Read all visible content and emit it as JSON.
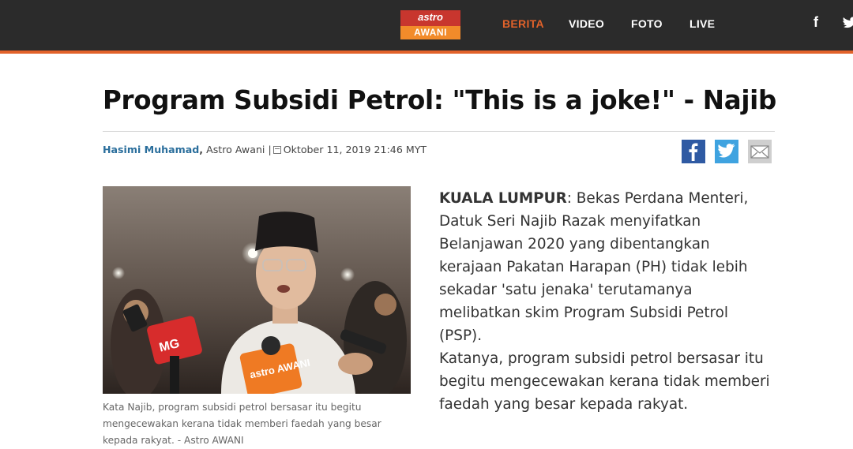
{
  "header": {
    "logo": {
      "top": "astro",
      "bottom": "AWANI"
    },
    "nav": [
      "BERITA",
      "VIDEO",
      "FOTO",
      "LIVE"
    ],
    "active_nav": "BERITA",
    "social": {
      "facebook": "f"
    },
    "accent_color": "#e2622a"
  },
  "article": {
    "title": "Program Subsidi Petrol: \"This is a joke!\" - Najib",
    "author": "Hasimi Muhamad",
    "source": "Astro Awani",
    "separator": "|",
    "date": "Oktober 11, 2019 21:46 MYT",
    "photo": {
      "mic_labels": [
        "MG",
        "astro AWANI"
      ],
      "caption": "Kata Najib, program subsidi petrol bersasar itu begitu mengecewakan kerana tidak memberi faedah yang besar kepada rakyat. - Astro AWANI"
    },
    "dateline": "KUALA LUMPUR",
    "paragraph1_rest": ": Bekas Perdana Menteri, Datuk Seri Najib Razak menyifatkan Belanjawan 2020 yang dibentangkan kerajaan Pakatan Harapan (PH) tidak lebih sekadar 'satu jenaka' terutamanya melibatkan skim Program Subsidi Petrol (PSP).",
    "paragraph2": "Katanya, program subsidi petrol bersasar itu begitu mengecewakan kerana tidak memberi faedah yang besar kepada rakyat."
  }
}
